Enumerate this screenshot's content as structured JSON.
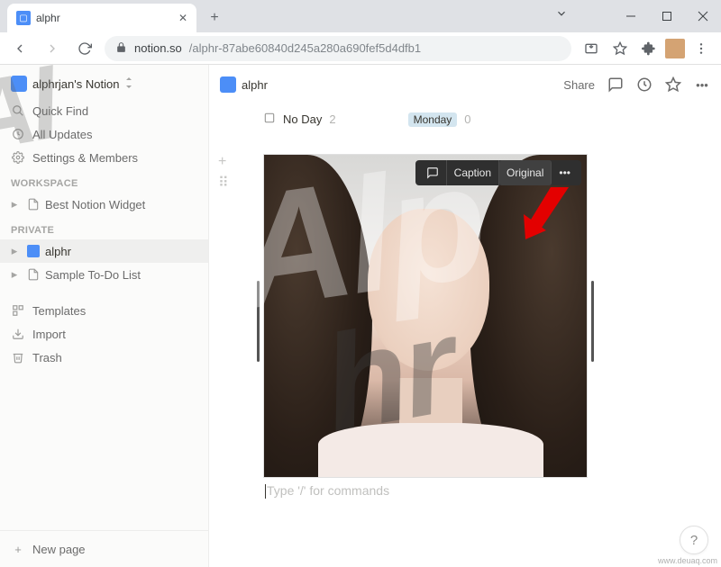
{
  "browser": {
    "tab_title": "alphr",
    "url_host": "notion.so",
    "url_path": "/alphr-87abe60840d245a280a690fef5d4dfb1"
  },
  "sidebar": {
    "workspace_name": "alphrjan's Notion",
    "quick_find": "Quick Find",
    "all_updates": "All Updates",
    "settings": "Settings & Members",
    "section_workspace": "WORKSPACE",
    "section_private": "PRIVATE",
    "pages_workspace": [
      {
        "label": "Best Notion Widget"
      }
    ],
    "pages_private": [
      {
        "label": "alphr"
      },
      {
        "label": "Sample To-Do List"
      }
    ],
    "templates": "Templates",
    "import": "Import",
    "trash": "Trash",
    "new_page": "New page"
  },
  "topbar": {
    "breadcrumb": "alphr",
    "share": "Share"
  },
  "board": {
    "col1_label": "No Day",
    "col1_count": "2",
    "col2_label": "Monday",
    "col2_count": "0"
  },
  "image_toolbar": {
    "caption": "Caption",
    "original": "Original"
  },
  "editor": {
    "placeholder": "Type '/' for commands"
  },
  "help": "?",
  "credit": "www.deuaq.com"
}
